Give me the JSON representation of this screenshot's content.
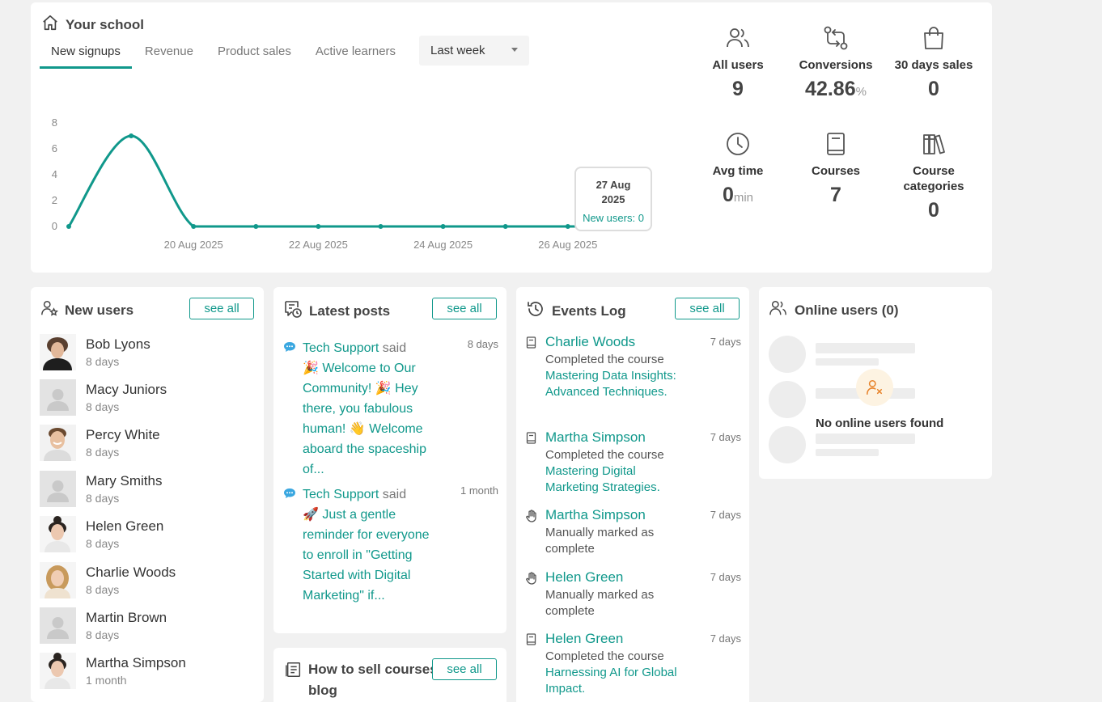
{
  "school": {
    "title": "Your school",
    "tabs": [
      "New signups",
      "Revenue",
      "Product sales",
      "Active learners"
    ],
    "period": "Last week",
    "tooltip": {
      "date": "27 Aug 2025",
      "value": "New users: 0"
    },
    "stats": {
      "all_users": {
        "label": "All users",
        "value": "9",
        "icon": "users-icon"
      },
      "conversions": {
        "label": "Conversions",
        "value": "42.86",
        "unit": "%",
        "icon": "conversion-arrows-icon"
      },
      "sales30": {
        "label": "30 days sales",
        "value": "0",
        "icon": "shopping-bag-icon"
      },
      "avg_time": {
        "label": "Avg time",
        "value": "0",
        "unit": "min",
        "icon": "clock-icon"
      },
      "courses": {
        "label": "Courses",
        "value": "7",
        "icon": "book-icon"
      },
      "categories": {
        "label": "Course categories",
        "value": "0",
        "icon": "library-icon"
      }
    }
  },
  "chart_data": {
    "type": "line",
    "x": [
      "21 Aug 2025",
      "22 Aug 2025",
      "23 Aug 2025",
      "24 Aug 2025",
      "25 Aug 2025",
      "26 Aug 2025",
      "27 Aug 2025"
    ],
    "x_full": [
      "18 Aug 2025",
      "19 Aug 2025",
      "20 Aug 2025",
      "21 Aug 2025",
      "22 Aug 2025",
      "23 Aug 2025",
      "24 Aug 2025",
      "25 Aug 2025",
      "26 Aug 2025",
      "27 Aug 2025"
    ],
    "values": [
      0,
      7,
      0,
      0,
      0,
      0,
      0,
      0,
      0,
      0
    ],
    "x_tick_labels": [
      "20 Aug 2025",
      "22 Aug 2025",
      "24 Aug 2025",
      "26 Aug 2025"
    ],
    "y_ticks": [
      0,
      2,
      4,
      6,
      8
    ],
    "ylim": [
      0,
      8
    ],
    "color": "#10988b",
    "grid": false
  },
  "new_users": {
    "title": "New users",
    "see_all": "see all",
    "items": [
      {
        "name": "Bob Lyons",
        "when": "8 days",
        "photo": "man-curly"
      },
      {
        "name": "Macy Juniors",
        "when": "8 days",
        "photo": "placeholder"
      },
      {
        "name": "Percy White",
        "when": "8 days",
        "photo": "man-smile"
      },
      {
        "name": "Mary Smiths",
        "when": "8 days",
        "photo": "placeholder"
      },
      {
        "name": "Helen Green",
        "when": "8 days",
        "photo": "woman-bun"
      },
      {
        "name": "Charlie Woods",
        "when": "8 days",
        "photo": "woman-blonde"
      },
      {
        "name": "Martin Brown",
        "when": "8 days",
        "photo": "placeholder"
      },
      {
        "name": "Martha Simpson",
        "when": "1 month",
        "photo": "woman-bun"
      }
    ]
  },
  "latest_posts": {
    "title": "Latest posts",
    "see_all": "see all",
    "items": [
      {
        "author": "Tech Support",
        "said": "said",
        "text": "🎉 Welcome to Our Community! 🎉 Hey there, you fabulous human! 👋 Welcome aboard the spaceship of...",
        "when": "8 days"
      },
      {
        "author": "Tech Support",
        "said": "said",
        "text": "🚀 Just a gentle reminder for everyone to enroll in \"Getting Started with Digital Marketing\" if...",
        "when": "1 month"
      }
    ]
  },
  "how_to_sell": {
    "title": "How to sell courses blog",
    "see_all": "see all"
  },
  "events_log": {
    "title": "Events Log",
    "see_all": "see all",
    "items": [
      {
        "name": "Charlie Woods",
        "action": "Completed the course",
        "course": "Mastering Data Insights: Advanced Techniques.",
        "when": "7 days",
        "icon": "book-icon"
      },
      {
        "name": "Martha Simpson",
        "action": "Completed the course",
        "course": "Mastering Digital Marketing Strategies.",
        "when": "7 days",
        "icon": "book-icon"
      },
      {
        "name": "Martha Simpson",
        "action": "Manually marked as complete",
        "course": "",
        "when": "7 days",
        "icon": "hand-icon"
      },
      {
        "name": "Helen Green",
        "action": "Manually marked as complete",
        "course": "",
        "when": "7 days",
        "icon": "hand-icon"
      },
      {
        "name": "Helen Green",
        "action": "Completed the course",
        "course": "Harnessing AI for Global Impact.",
        "when": "7 days",
        "icon": "book-icon"
      }
    ]
  },
  "online_users": {
    "title": "Online users (0)",
    "empty": "No online users found"
  }
}
